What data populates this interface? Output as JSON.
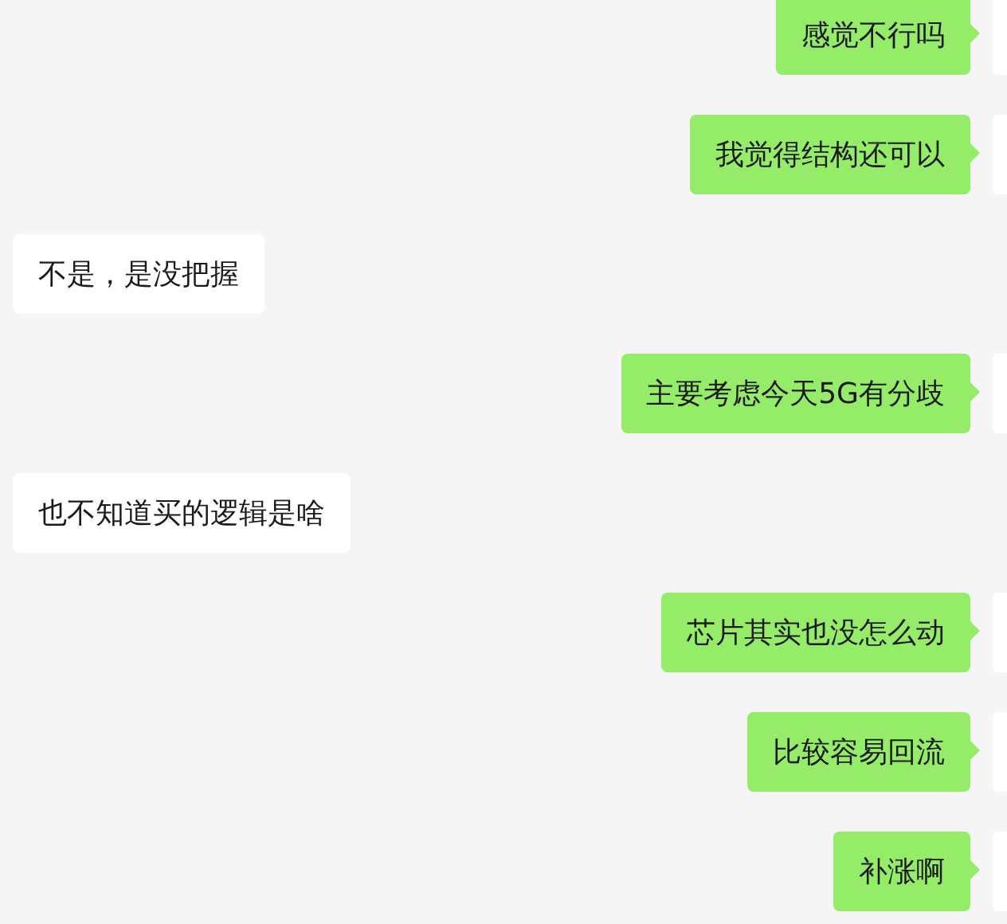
{
  "messages": [
    {
      "kind": "sent",
      "text": "感觉不行吗"
    },
    {
      "kind": "sent",
      "text": "我觉得结构还可以"
    },
    {
      "kind": "received",
      "text": "不是，是没把握"
    },
    {
      "kind": "sent",
      "text": "主要考虑今天5G有分歧"
    },
    {
      "kind": "received",
      "text": "也不知道买的逻辑是啥"
    },
    {
      "kind": "sent",
      "text": "芯片其实也没怎么动"
    },
    {
      "kind": "sent",
      "text": "比较容易回流"
    },
    {
      "kind": "sent",
      "text": "补涨啊"
    }
  ]
}
